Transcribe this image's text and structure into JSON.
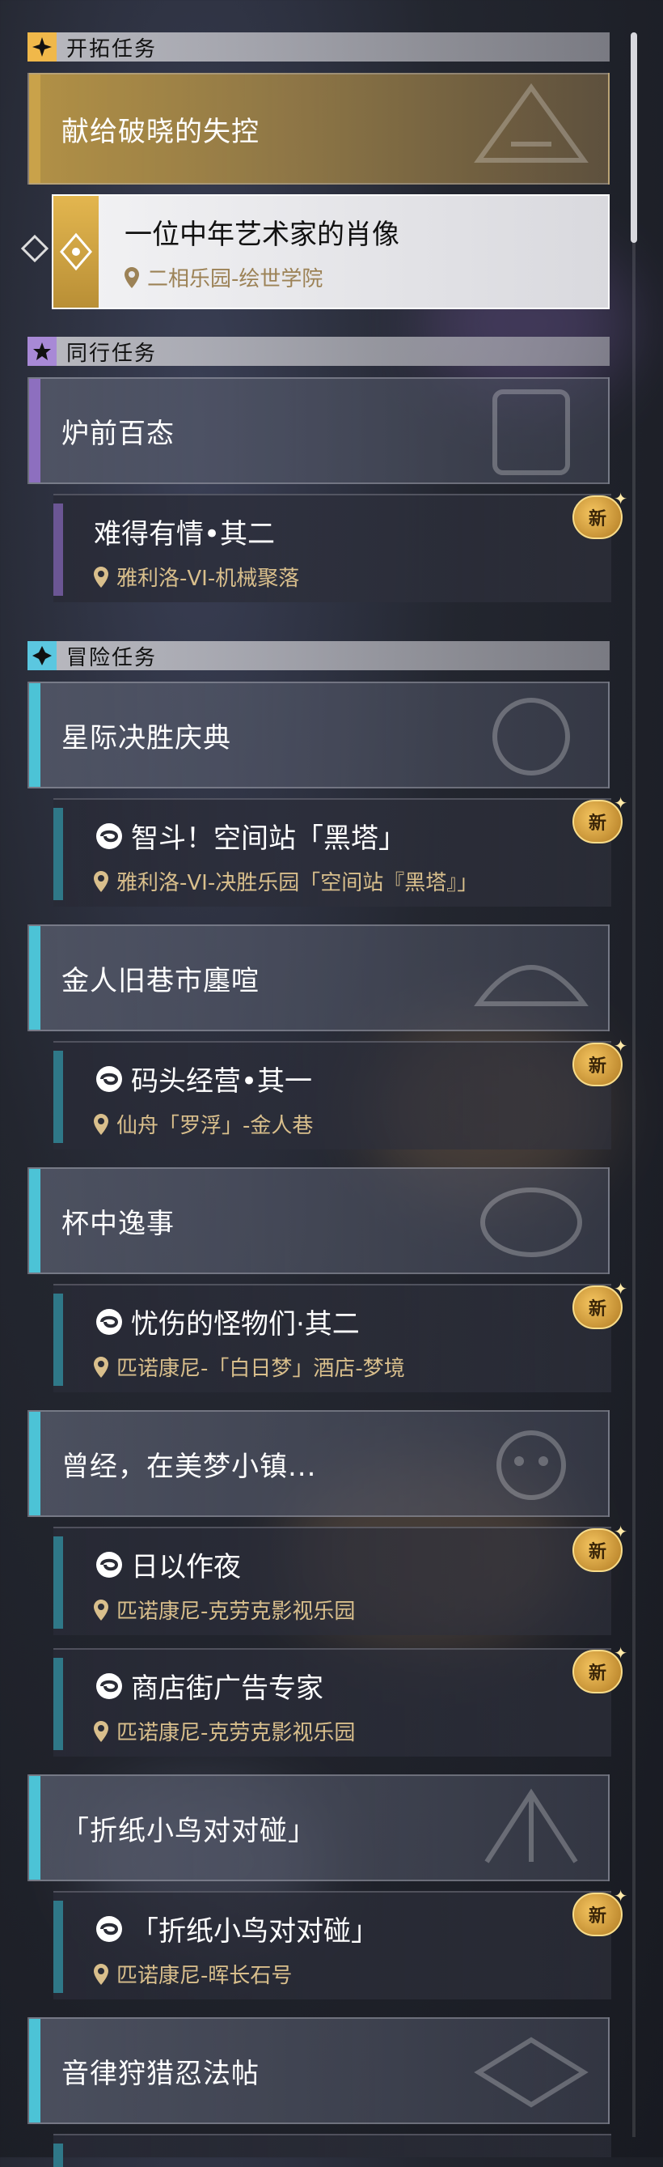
{
  "sections": {
    "trailblaze": {
      "title": "开拓任务"
    },
    "companion": {
      "title": "同行任务"
    },
    "adventure": {
      "title": "冒险任务"
    }
  },
  "trailblaze": {
    "group_title": "献给破晓的失控",
    "quest": {
      "title": "一位中年艺术家的肖像",
      "location": "二相乐园-绘世学院"
    }
  },
  "companion": {
    "group_title": "炉前百态",
    "quest": {
      "title": "难得有情•其二",
      "location": "雅利洛-VI-机械聚落",
      "badge": "新"
    }
  },
  "adventure": {
    "groups": [
      {
        "title": "星际决胜庆典",
        "quests": [
          {
            "title": "智斗！空间站「黑塔」",
            "location": "雅利洛-VI-决胜乐园「空间站『黑塔』」",
            "badge": "新"
          }
        ]
      },
      {
        "title": "金人旧巷市廛喧",
        "quests": [
          {
            "title": "码头经营•其一",
            "location": "仙舟「罗浮」-金人巷",
            "badge": "新"
          }
        ]
      },
      {
        "title": "杯中逸事",
        "quests": [
          {
            "title": "忧伤的怪物们·其二",
            "location": "匹诺康尼-「白日梦」酒店-梦境",
            "badge": "新"
          }
        ]
      },
      {
        "title": "曾经，在美梦小镇...",
        "quests": [
          {
            "title": "日以作夜",
            "location": "匹诺康尼-克劳克影视乐园",
            "badge": "新"
          },
          {
            "title": "商店街广告专家",
            "location": "匹诺康尼-克劳克影视乐园",
            "badge": "新"
          }
        ]
      },
      {
        "title": "「折纸小鸟对对碰」",
        "quests": [
          {
            "title": "「折纸小鸟对对碰」",
            "location": "匹诺康尼-晖长石号",
            "badge": "新"
          }
        ]
      },
      {
        "title": "音律狩猎忍法帖",
        "quests": []
      }
    ]
  },
  "colors": {
    "trailblaze_bar": "#c9a24a",
    "companion_bar": "#8d6fbf",
    "adventure_bar": "#4cc3d6",
    "location_text": "#d9bf8c"
  }
}
